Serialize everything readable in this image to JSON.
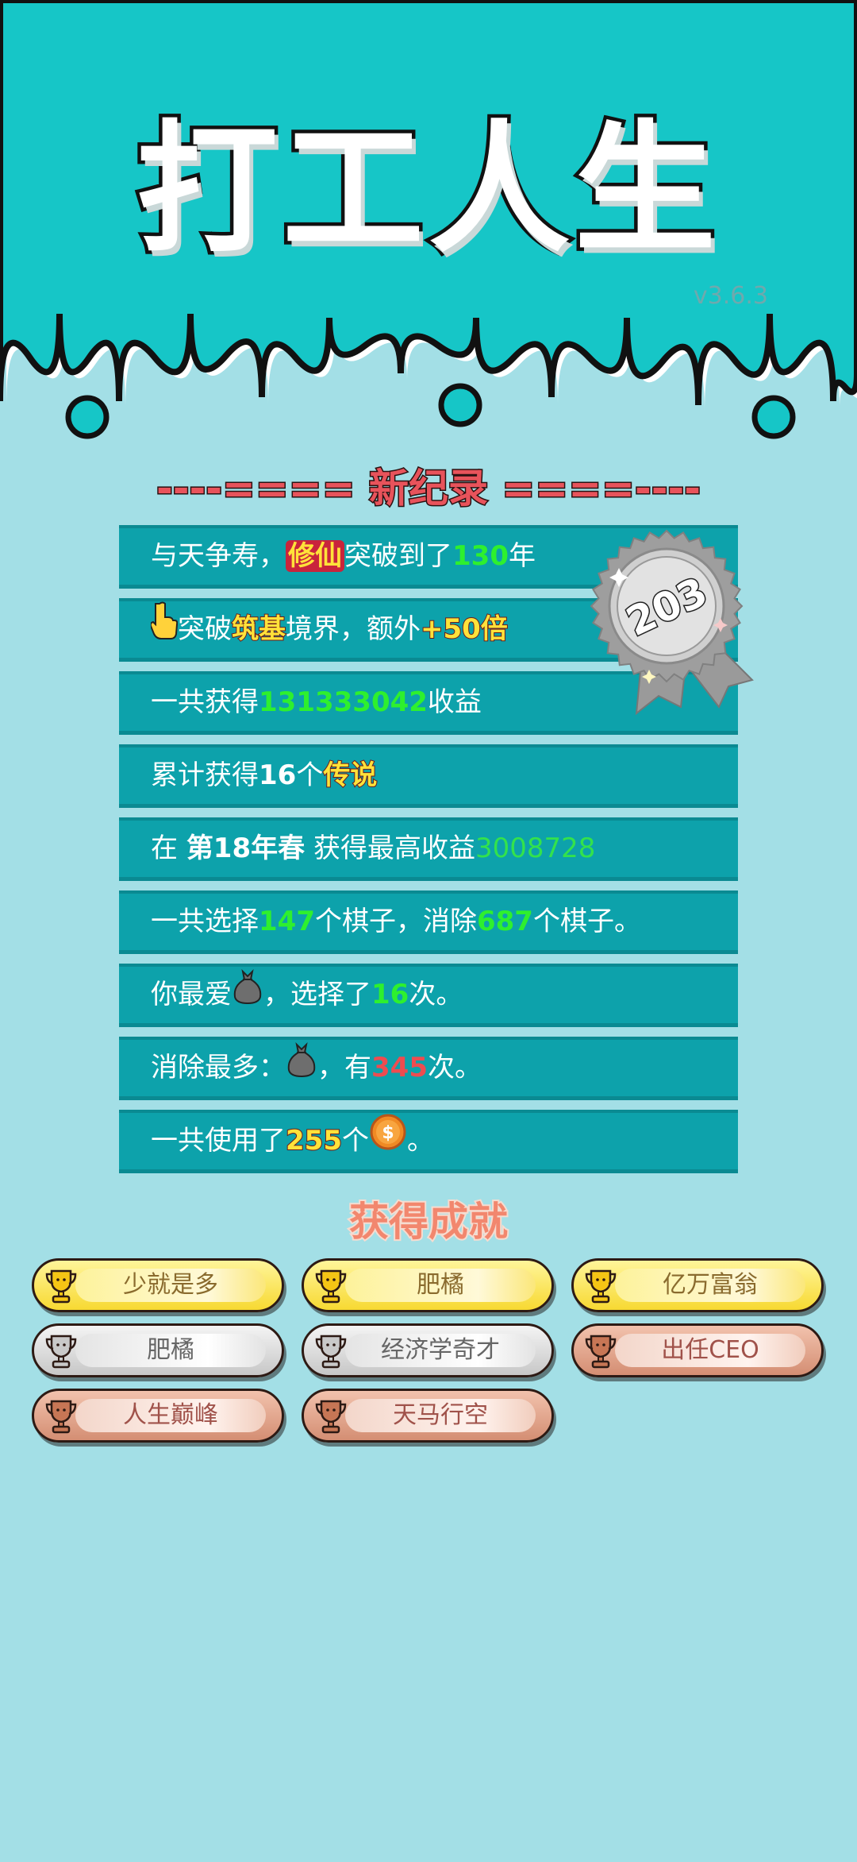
{
  "header": {
    "title": "打工人生",
    "version": "v3.6.3"
  },
  "record_heading": "----==== 新纪录 ====----",
  "badge": {
    "value": "203"
  },
  "stats": [
    {
      "a": "与天争寿，",
      "b": "修仙",
      "c": "突破到了",
      "d": "130",
      "e": "年"
    },
    {
      "a": "突破",
      "b": "筑基",
      "c": "境界，额外",
      "d": "+50倍"
    },
    {
      "a": "一共获得",
      "b": "131333042",
      "c": "收益"
    },
    {
      "a": "累计获得",
      "b": "16",
      "c": "个",
      "d": "传说"
    },
    {
      "a": "在 ",
      "b": "第18年春",
      "c": " 获得最高收益",
      "d": "3008728"
    },
    {
      "a": "一共选择",
      "b": "147",
      "c": "个棋子，消除",
      "d": "687",
      "e": "个棋子。"
    },
    {
      "a": "你最爱",
      "b": "，选择了",
      "c": "16",
      "d": "次。"
    },
    {
      "a": "消除最多：",
      "b": "，有",
      "c": "345",
      "d": "次。"
    },
    {
      "a": "一共使用了",
      "b": "255",
      "c": "个",
      "d": "。"
    }
  ],
  "achievements_title": "获得成就",
  "achievements": [
    {
      "label": "少就是多",
      "tier": "gold"
    },
    {
      "label": "肥橘",
      "tier": "gold"
    },
    {
      "label": "亿万富翁",
      "tier": "gold"
    },
    {
      "label": "肥橘",
      "tier": "silver"
    },
    {
      "label": "经济学奇才",
      "tier": "silver"
    },
    {
      "label": "出任CEO",
      "tier": "bronze"
    },
    {
      "label": "人生巅峰",
      "tier": "bronze"
    },
    {
      "label": "天马行空",
      "tier": "bronze"
    }
  ],
  "colors": {
    "background": "#a3dfe6",
    "header": "#16c6c7",
    "row": "#0da2ab",
    "green": "#2ef02e",
    "yellow": "#ffe23a",
    "red": "#ee4c50"
  },
  "icons": [
    "pointing-hand-icon",
    "bag-icon",
    "coin-icon",
    "trophy-icon",
    "medal-badge-icon"
  ]
}
